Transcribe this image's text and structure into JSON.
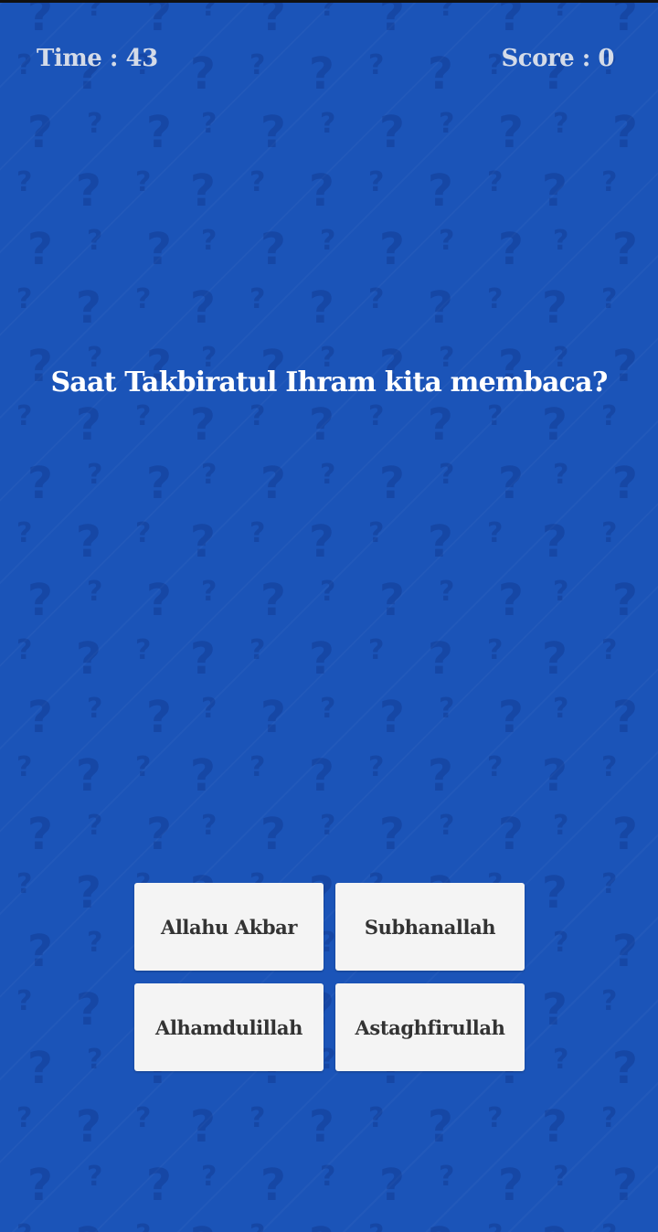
{
  "hud": {
    "time_label": "Time : 43",
    "score_label": "Score : 0"
  },
  "question": {
    "text": "Saat Takbiratul Ihram kita membaca?"
  },
  "answers": [
    {
      "label": "Allahu Akbar"
    },
    {
      "label": "Subhanallah"
    },
    {
      "label": "Alhamdulillah"
    },
    {
      "label": "Astaghfirullah"
    }
  ],
  "colors": {
    "background": "#1b54b8",
    "button": "#f4f4f4",
    "button_text": "#333333",
    "question_text": "#ffffff",
    "hud_text": "#d4dbe8"
  },
  "background_pattern": {
    "icon": "question-mark-icon"
  }
}
